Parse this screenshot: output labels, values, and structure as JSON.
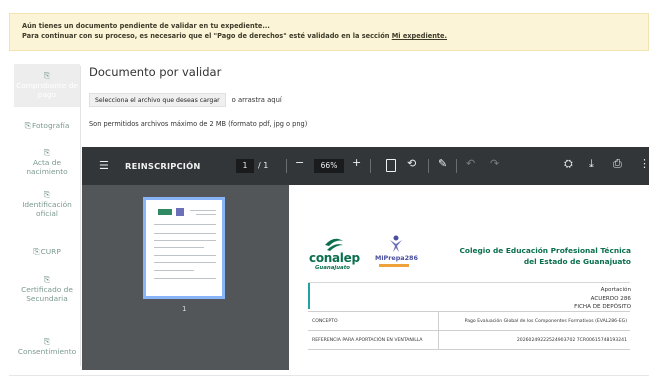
{
  "alert": {
    "line1": "Aún tienes un documento pendiente de validar en tu expediente...",
    "line2_prefix": "Para continuar con su proceso, es necesario que el \"Pago de derechos\" esté validado en la sección",
    "line2_link": "Mi expediente."
  },
  "sidebar": {
    "icon": "document-icon",
    "items": [
      {
        "label": "Comprobante de pago",
        "active": true
      },
      {
        "label": "Fotografía"
      },
      {
        "label": "Acta de nacimiento"
      },
      {
        "label": "Identificación oficial"
      },
      {
        "label": "CURP"
      },
      {
        "label": "Certificado de Secundaria"
      },
      {
        "label": "Consentimiento"
      }
    ]
  },
  "main": {
    "title": "Documento por validar",
    "file_button": "Selecciona el archivo que deseas cargar",
    "drag_text": "o arrastra aquí",
    "hint": "Son permitidos archivos máximo de 2 MB (formato pdf, jpg o png)"
  },
  "viewer": {
    "title": "REINSCRIPCIÓN",
    "page_current": "1",
    "page_total": "/ 1",
    "zoom": "66%",
    "thumbnail_number": "1",
    "icons": [
      "menu-icon",
      "zoom-out-icon",
      "zoom-in-icon",
      "fit-page-icon",
      "rotate-icon",
      "annotate-icon",
      "undo-icon",
      "redo-icon",
      "add-signature-icon",
      "download-icon",
      "print-icon",
      "more-icon"
    ]
  },
  "document": {
    "logo1_name": "conalep",
    "logo1_sub": "Guanajuato",
    "logo2_name": "MiPrepa286",
    "college_line1": "Colegio de Educación Profesional Técnica",
    "college_line2": "del Estado de Guanajuato",
    "fee_line1": "Aportación",
    "fee_line2": "ACUERDO 286",
    "fee_line3": "FICHA DE DEPÓSITO",
    "rows": [
      {
        "label": "CONCEPTO",
        "value": "Pago Evaluación Global de los Componentes Formativos (EVAL286-EG)"
      },
      {
        "label": "REFERENCIA PARA APORTACIÓN EN VENTANILLA",
        "value": "20260249222524903702 7CR00615748193241"
      }
    ]
  },
  "colors": {
    "alert_bg": "#fcf4d6",
    "toolbar": "#323639",
    "viewer_bg": "#525659",
    "conalep_green": "#0a6f4c",
    "accent_teal": "#1fa3a0"
  }
}
